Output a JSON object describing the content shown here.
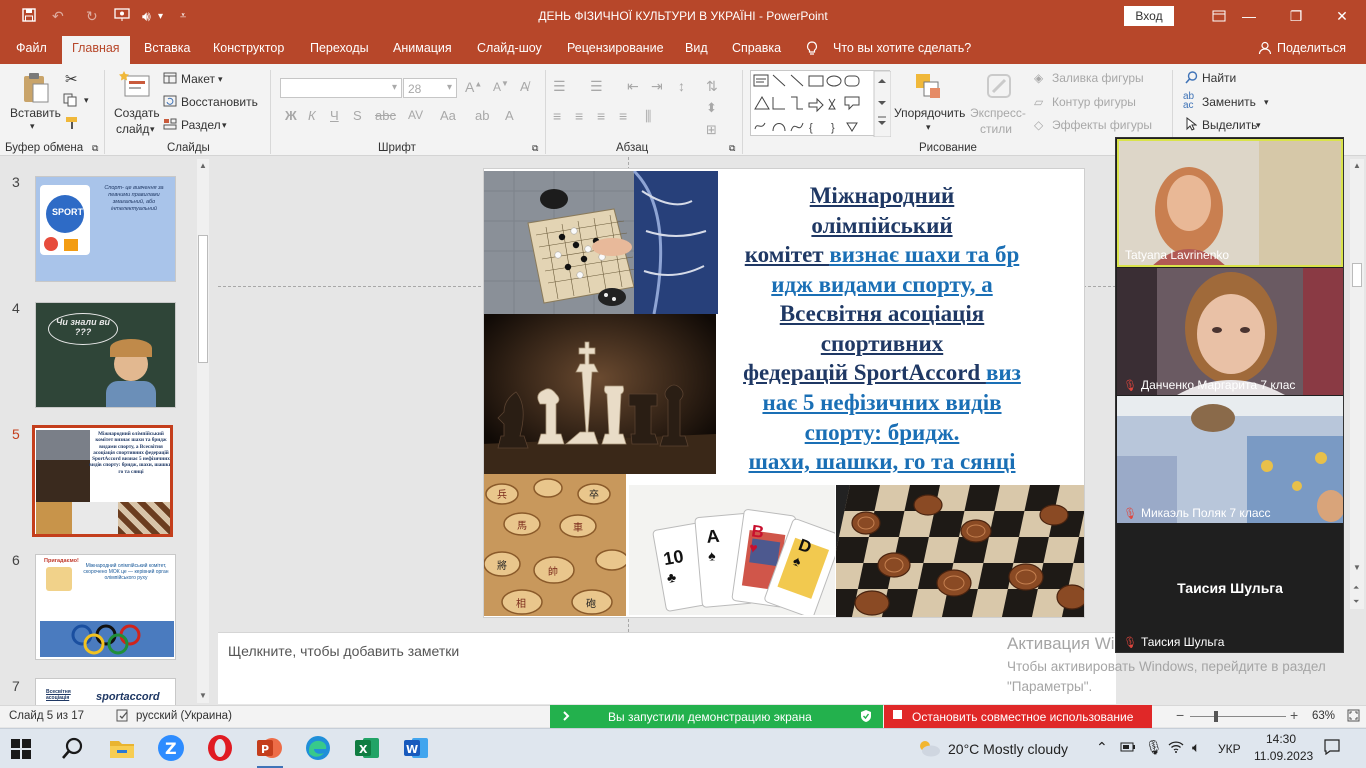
{
  "window": {
    "title": "ДЕНЬ ФІЗИЧНОЇ КУЛЬТУРИ В УКРАЇНІ  -  PowerPoint",
    "signin": "Вход"
  },
  "tabs": [
    {
      "label": "Файл"
    },
    {
      "label": "Главная"
    },
    {
      "label": "Вставка"
    },
    {
      "label": "Конструктор"
    },
    {
      "label": "Переходы"
    },
    {
      "label": "Анимация"
    },
    {
      "label": "Слайд-шоу"
    },
    {
      "label": "Рецензирование"
    },
    {
      "label": "Вид"
    },
    {
      "label": "Справка"
    }
  ],
  "tell_me": "Что вы хотите сделать?",
  "share": "Поделиться",
  "ribbon": {
    "clipboard": {
      "paste": "Вставить",
      "label": "Буфер обмена"
    },
    "slides": {
      "new_slide": "Создать",
      "new_slide2": "слайд",
      "layout": "Макет",
      "reset": "Восстановить",
      "section": "Раздел",
      "label": "Слайды"
    },
    "font": {
      "size": "28",
      "label": "Шрифт"
    },
    "paragraph": {
      "label": "Абзац"
    },
    "drawing": {
      "arrange": "Упорядочить",
      "quick_styles": "Экспресс-",
      "quick_styles2": "стили",
      "fill": "Заливка фигуры",
      "outline": "Контур фигуры",
      "effects": "Эффекты фигуры",
      "label": "Рисование"
    },
    "editing": {
      "find": "Найти",
      "replace": "Заменить",
      "select": "Выделить"
    }
  },
  "thumbnails": [
    {
      "num": "3",
      "text": "Спорт- це вивчення за певними правилами змагальний, або інтелектуальний"
    },
    {
      "num": "4",
      "text": "Чи знали ви ???"
    },
    {
      "num": "5",
      "text": "Міжнародний олімпійський комітет визнає шахи та бридж видами спорту, а Всесвітня асоціація спортивних федерацій SportAccord визнає 5 нефізичних видів спорту: бридж, шахи, шашки, го та сянці"
    },
    {
      "num": "6",
      "title": "Пригадаємо!",
      "text": "Міжнародний олімпійський комітет, скорочено МОК це — керівний орган олімпійського руху"
    },
    {
      "num": "7",
      "text": "Всесвітня асоціація",
      "logo": "sportaccord"
    }
  ],
  "slide": {
    "line1": "Міжнародний",
    "line2": "олімпійський",
    "line3a": "комітет ",
    "line3b": "визнає шахи та бр",
    "line4": "идж видами спорту, а",
    "line5": "Всесвітня асоціація",
    "line6": "спортивних",
    "line7a": "федерацій SportAccord ",
    "line7b": "виз",
    "line8": "нає 5 нефізичних видів",
    "line9": "спорту: бридж.",
    "line10": "шахи, шашки, го та сянці",
    "card_rank1": "10",
    "card_rank2": "A",
    "card_rank3": "B",
    "card_rank4": "D"
  },
  "notes_placeholder": "Щелкните, чтобы добавить заметки",
  "participants": [
    {
      "name": "Tatyana Lavrinenko",
      "muted": false
    },
    {
      "name": "Данченко Маргарита 7 клас",
      "muted": true
    },
    {
      "name": "Микаэль Поляк 7 класс",
      "muted": true
    },
    {
      "name": "Таисия Шульга",
      "muted": true,
      "center_name": "Таисия Шульга"
    }
  ],
  "activation": {
    "title": "Активация Windows",
    "text": "Чтобы активировать Windows, перейдите в раздел \"Параметры\"."
  },
  "status": {
    "slide": "Слайд 5 из 17",
    "language": "русский (Украина)",
    "zoom": "63%",
    "share_started": "Вы запустили демонстрацию экрана",
    "stop_share": "Остановить совместное использование"
  },
  "taskbar": {
    "weather": "20°C  Mostly cloudy",
    "lang": "УКР",
    "time": "14:30",
    "date": "11.09.2023"
  },
  "colors": {
    "accent": "#b7472a",
    "selection": "#c43e1c",
    "slide_text": "#1f3864",
    "slide_link": "#1a6fb5",
    "share_green": "#23b14d",
    "share_red": "#e02828"
  }
}
